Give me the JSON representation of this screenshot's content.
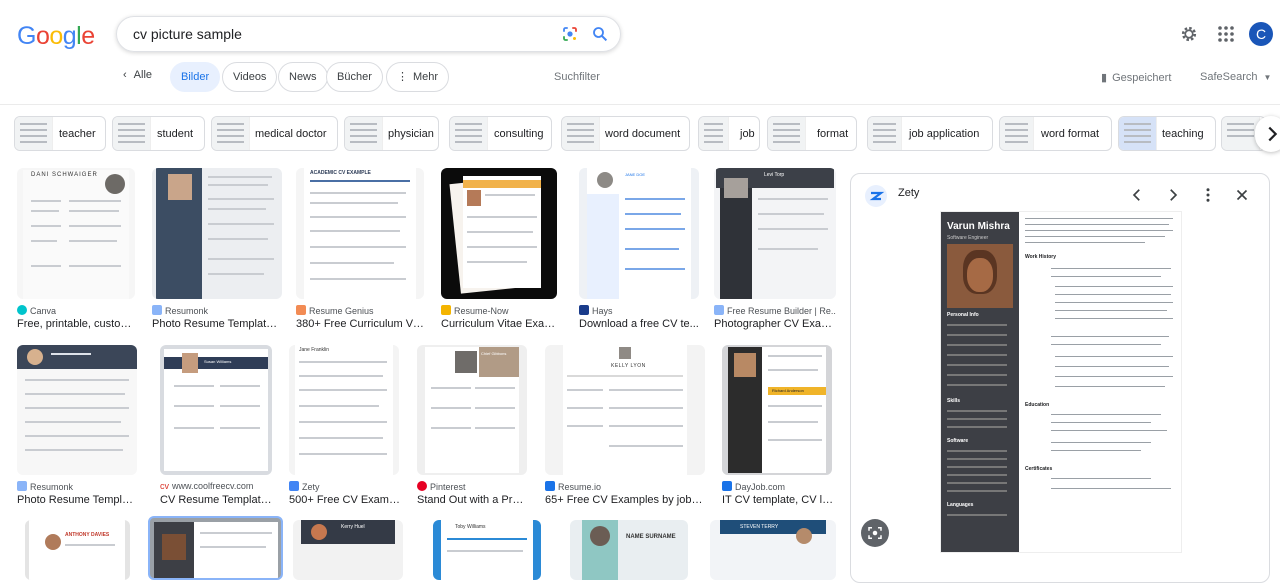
{
  "header": {
    "logo": "Google",
    "query": "cv picture sample",
    "avatar_letter": "C"
  },
  "colors": {
    "blue": "#4285f4",
    "red": "#ea4335",
    "yellow": "#fbbc05",
    "green": "#34a853",
    "accent": "#1a73e8"
  },
  "tabs": {
    "back": "Alle",
    "items": [
      "Bilder",
      "Videos",
      "News",
      "Bücher",
      "Mehr"
    ],
    "active": "Bilder",
    "tools": "Suchfilter",
    "saved": "Gespeichert",
    "safesearch": "SafeSearch"
  },
  "chips": [
    "teacher",
    "student",
    "medical doctor",
    "physician",
    "consulting",
    "word document",
    "job",
    "format",
    "job application",
    "word format",
    "teaching"
  ],
  "results_row1": [
    {
      "source": "Canva",
      "title": "Free, printable, custom..."
    },
    {
      "source": "Resumonk",
      "title": "Photo Resume Templates..."
    },
    {
      "source": "Resume Genius",
      "title": "380+ Free Curriculum Vi..."
    },
    {
      "source": "Resume-Now",
      "title": "Curriculum Vitae Examp..."
    },
    {
      "source": "Hays",
      "title": "Download a free CV te..."
    },
    {
      "source": "Free Resume Builder | Re...",
      "title": "Photographer CV Exam..."
    }
  ],
  "results_row2": [
    {
      "source": "Resumonk",
      "title": "Photo Resume Template..."
    },
    {
      "source": "www.coolfreecv.com",
      "title": "CV Resume Template..."
    },
    {
      "source": "Zety",
      "title": "500+ Free CV Exampl..."
    },
    {
      "source": "Pinterest",
      "title": "Stand Out with a Prof..."
    },
    {
      "source": "Resume.io",
      "title": "65+ Free CV Examples by job (F..."
    },
    {
      "source": "DayJob.com",
      "title": "IT CV template, CV lib..."
    }
  ],
  "thumb_texts": {
    "t1": "DANI SCHWAIGER",
    "t3": "ACADEMIC CV EXAMPLE",
    "t5": "JANE DOE",
    "t6": "Levi Torp",
    "t8": "Susan Williams",
    "t9": "Jane Franklin",
    "t10": "Chief Gibbons",
    "t11": "KELLY LYON",
    "t12": "Richard Anderson",
    "t13": "ANTHONY DAVIES",
    "t15": "Kerry Huel",
    "t16": "Toby Williams",
    "t17": "NAME SURNAME",
    "t18": "STEVEN TERRY"
  },
  "panel": {
    "source": "Zety",
    "name": "Varun Mishra",
    "role": "Software Engineer",
    "side_sections": [
      "Personal Info",
      "Skills",
      "Software",
      "Languages"
    ],
    "main_sections": [
      "Work History",
      "Education",
      "Certificates"
    ]
  }
}
